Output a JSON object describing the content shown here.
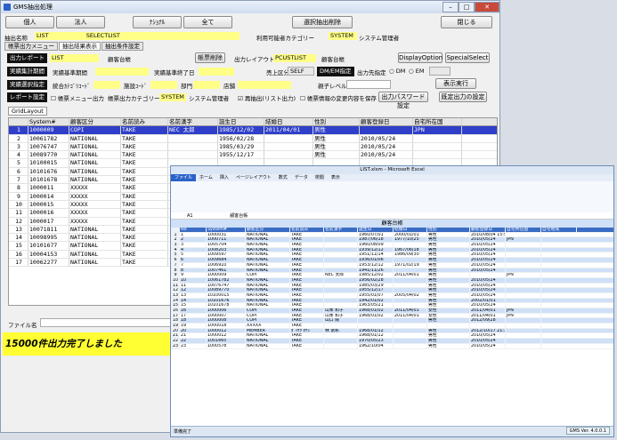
{
  "window": {
    "title": "GMS抽出処理"
  },
  "top_buttons": [
    "個人",
    "法人",
    "ﾅｼｮﾅﾙ",
    "全て",
    "選択抽出削除",
    "閉じる"
  ],
  "extract": {
    "name_label": "抽出名称",
    "name_value": "LIST",
    "select_value": "SELECTLIST",
    "category_label": "利用可能者カテゴリー",
    "category_value": "SYSTEM",
    "category_name": "システム管理者"
  },
  "tabs": [
    "帳票出力メニュー",
    "抽出結果表示",
    "抽出条件設定"
  ],
  "form": {
    "report_out": "出力レポート",
    "report_value": "LIST",
    "report_name": "顧客台帳",
    "report_delete": "帳票削除",
    "layout_label": "出力レイアウト",
    "layout_value": "PCUSTLIST",
    "layout_name": "顧客台帳",
    "display_option": "DisplayOption",
    "special_select": "SpecialSelect",
    "actual_period": "実績集計期間",
    "period_base": "実績基準期間",
    "period_base_date": "実績基準終了日",
    "sales_label": "売上区分",
    "sales_value": "SELF",
    "dm": "DM/EM指定",
    "out_target": "出力先指定",
    "dm_opt": "DM",
    "em_opt": "EM",
    "actual_select": "実績選択指定",
    "class_label": "統合ｶﾃｺﾞﾘｺｰﾄﾞ",
    "dept_code": "施設ｺｰﾄﾞ",
    "dept_label": "部門",
    "store_label": "店舗",
    "parent_level": "親子レベル",
    "show_run": "表示実行",
    "report_settings": "レポート設定",
    "report_menu_out": "帳票メニュー出力",
    "report_category": "帳票出力カテゴリー",
    "report_cat_value": "SYSTEM",
    "report_cat_name": "システム管理者",
    "reextract": "再抽出(リスト出力)",
    "save_changes": "帳票情報の変更内容を保存",
    "pw_settings": "出力パスワード設定",
    "def_out": "既定出力の設定"
  },
  "grid": {
    "label": "GridLayout",
    "headers": [
      "",
      "System#",
      "顧客区分",
      "名前読み",
      "名前漢字",
      "誕生日",
      "結婚日",
      "性別",
      "顧客登録日",
      "自宅所在国"
    ],
    "rows": [
      [
        "1",
        "1000009",
        "COPI",
        "TAKE",
        "NEC 太郎",
        "1985/12/02",
        "2011/04/01",
        "男性",
        "",
        "JPN"
      ],
      [
        "2",
        "10061782",
        "NATIONAL",
        "TAKE",
        "",
        "1956/02/28",
        "",
        "男性",
        "2010/05/24",
        ""
      ],
      [
        "3",
        "10076747",
        "NATIONAL",
        "TAKE",
        "",
        "1985/03/29",
        "",
        "男性",
        "2010/05/24",
        ""
      ],
      [
        "4",
        "10089770",
        "NATIONAL",
        "TAKE",
        "",
        "1955/12/17",
        "",
        "男性",
        "2010/05/24",
        ""
      ],
      [
        "5",
        "10100015",
        "NATIONAL",
        "TAKE",
        "",
        "",
        "",
        "",
        "",
        ""
      ],
      [
        "6",
        "10101676",
        "NATIONAL",
        "TAKE",
        "",
        "",
        "",
        "",
        "",
        ""
      ],
      [
        "7",
        "10101678",
        "NATIONAL",
        "TAKE",
        "",
        "",
        "",
        "",
        "",
        ""
      ],
      [
        "8",
        "1000011",
        "XXXXX",
        "TAKE",
        "",
        "",
        "",
        "",
        "",
        ""
      ],
      [
        "9",
        "1000014",
        "XXXXX",
        "TAKE",
        "",
        "",
        "",
        "",
        "",
        ""
      ],
      [
        "10",
        "1000015",
        "XXXXX",
        "TAKE",
        "",
        "",
        "",
        "",
        "",
        ""
      ],
      [
        "11",
        "1000016",
        "XXXXX",
        "TAKE",
        "",
        "",
        "",
        "",
        "",
        ""
      ],
      [
        "12",
        "1000017",
        "XXXXX",
        "TAKE",
        "",
        "",
        "",
        "",
        "",
        ""
      ],
      [
        "13",
        "10071811",
        "NATIONAL",
        "TAKE",
        "",
        "",
        "",
        "",
        "",
        ""
      ],
      [
        "14",
        "10098995",
        "NATIONAL",
        "TAKE",
        "",
        "",
        "",
        "",
        "",
        ""
      ],
      [
        "15",
        "10101677",
        "NATIONAL",
        "TAKE",
        "",
        "",
        "",
        "",
        "",
        ""
      ],
      [
        "16",
        "10004153",
        "NATIONAL",
        "TAKE",
        "",
        "",
        "",
        "",
        "",
        ""
      ],
      [
        "17",
        "10062277",
        "NATIONAL",
        "TAKE",
        "",
        "",
        "",
        "",
        "",
        ""
      ]
    ]
  },
  "file_label": "ファイル名",
  "status_text": "15000件出力完了しました",
  "excel": {
    "title": "LIST.xlsm - Microsoft Excel",
    "tabs": [
      "ファイル",
      "ホーム",
      "挿入",
      "ページレイアウト",
      "数式",
      "データ",
      "校閲",
      "表示"
    ],
    "cell_ref": "A1",
    "formula": "顧客台帳",
    "sheet_title": "顧客台帳",
    "headers": [
      "",
      "No",
      "System#",
      "顧客区分",
      "名前読み",
      "名前漢字",
      "誕生日",
      "結婚日",
      "性別",
      "顧客登録日",
      "自宅所在国",
      "自宅地域"
    ],
    "rows": [
      [
        "1",
        "1",
        "1000031",
        "NATIONAL",
        "TAKE",
        "",
        "1960/07/01",
        "2000/01/01",
        "男性",
        "2010/08/04 15:50",
        ""
      ],
      [
        "2",
        "2",
        "1000711",
        "NATIONAL",
        "TAKE",
        "",
        "1987/06/18",
        "1977/10/25",
        "男性",
        "2010/05/24",
        "JPN"
      ],
      [
        "3",
        "3",
        "1005704",
        "NATIONAL",
        "TAKE",
        "",
        "1960/08/09",
        "",
        "男性",
        "2010/05/24",
        ""
      ],
      [
        "4",
        "4",
        "1008203",
        "NATIONAL",
        "TAKE",
        "",
        "1939/12/12",
        "1967/06/18",
        "男性",
        "2010/05/24",
        ""
      ],
      [
        "5",
        "5",
        "1009597",
        "NATIONAL",
        "TAKE",
        "",
        "1951/11/14",
        "1986/09/30",
        "男性",
        "2010/05/24",
        ""
      ],
      [
        "6",
        "6",
        "1009684",
        "NATIONAL",
        "TAKE",
        "",
        "1936/01/06",
        "",
        "男性",
        "2010/05/24",
        ""
      ],
      [
        "7",
        "7",
        "1006910",
        "NATIONAL",
        "TAKE",
        "",
        "1953/12/12",
        "1971/02/19",
        "男性",
        "2010/05/24",
        ""
      ],
      [
        "8",
        "8",
        "1007461",
        "NATIONAL",
        "TAKE",
        "",
        "1941/11/26",
        "",
        "男性",
        "2010/05/24",
        ""
      ],
      [
        "9",
        "9",
        "1000009",
        "COPI",
        "TAKE",
        "NEC 太郎",
        "1985/12/02",
        "2011/04/01",
        "男性",
        "",
        "JPN"
      ],
      [
        "10",
        "10",
        "10061782",
        "NATIONAL",
        "TAKE",
        "",
        "1956/02/28",
        "",
        "男性",
        "2010/05/24",
        ""
      ],
      [
        "11",
        "11",
        "10076747",
        "NATIONAL",
        "TAKE",
        "",
        "1985/03/29",
        "",
        "男性",
        "2010/05/24",
        ""
      ],
      [
        "12",
        "12",
        "10089770",
        "NATIONAL",
        "TAKE",
        "",
        "1955/12/17",
        "",
        "男性",
        "2010/05/24",
        ""
      ],
      [
        "13",
        "13",
        "10100015",
        "NATIONAL",
        "TAKE",
        "",
        "1955/01/07",
        "2005/04/02",
        "男性",
        "2010/05/24",
        ""
      ],
      [
        "14",
        "14",
        "10101676",
        "NATIONAL",
        "TAKE",
        "",
        "1942/01/02",
        "",
        "男性",
        "2002/01/01",
        ""
      ],
      [
        "15",
        "15",
        "10101678",
        "NATIONAL",
        "TAKE",
        "",
        "1963/05/21",
        "",
        "男性",
        "2010/05/24",
        ""
      ],
      [
        "16",
        "16",
        "1000006",
        "COPI",
        "TAKE",
        "山本 和子",
        "1968/01/02",
        "2011/04/01",
        "女性",
        "2011/04/01",
        "JPN"
      ],
      [
        "17",
        "17",
        "1000007",
        "COPI",
        "TAKE",
        "山本 和子",
        "1968/01/02",
        "2011/04/01",
        "女性",
        "2011/04/01",
        "JPN"
      ],
      [
        "18",
        "18",
        "1000008",
        "COPI",
        "TAKE",
        "山口 陽",
        "",
        "",
        "男性",
        "2012/09/28",
        ""
      ],
      [
        "19",
        "19",
        "1000018",
        "XXXXX",
        "TAKE",
        "",
        "",
        "",
        "",
        "",
        ""
      ],
      [
        "20",
        "20",
        "1000012",
        "MEMBER",
        "ﾀﾞｲｻｸ ﾀｹｼ",
        "林 武彰",
        "1968/01/12",
        "",
        "男性",
        "2012/10/17 21:39",
        ""
      ],
      [
        "21",
        "21",
        "1000012",
        "NATIONAL",
        "TAKE",
        "",
        "1968/01/12",
        "",
        "男性",
        "2010/05/24",
        ""
      ],
      [
        "22",
        "22",
        "1001665",
        "NATIONAL",
        "TAKE",
        "",
        "1970/05/23",
        "",
        "男性",
        "2010/05/24",
        ""
      ],
      [
        "23",
        "23",
        "1000578",
        "NATIONAL",
        "TAKE",
        "",
        "1962/10/04",
        "",
        "男性",
        "2010/05/24",
        ""
      ]
    ],
    "status": "準備完了",
    "taskbar": "GMS Ver. 4.0.0.1"
  }
}
